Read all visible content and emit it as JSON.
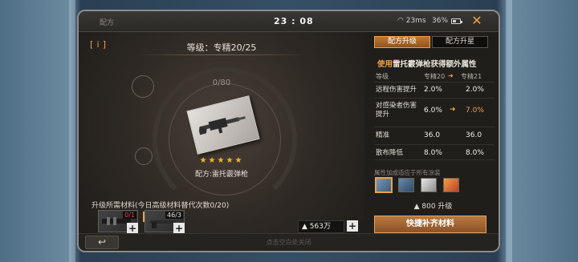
{
  "statusbar": {
    "title": "配方",
    "time": "23 : 08",
    "wifi": "23ms",
    "battery": "36%"
  },
  "left": {
    "level": "等级：专精20/25",
    "progress": "0/80",
    "stars": "★★★★★",
    "item_name": "配方:雷托霰弹枪",
    "materials_label": "升级所需材料(今日高级材料替代次数0/20)",
    "materials": [
      {
        "count": "0/1",
        "count_color": "#e04040"
      },
      {
        "count": "46/3",
        "count_color": "#f0ece4"
      }
    ],
    "currency": "563万"
  },
  "right": {
    "tabs": [
      "配方升级",
      "配方升星"
    ],
    "bonus_title_accent": "使用",
    "bonus_title_rest": "雷托霰弹枪获得额外属性",
    "header": {
      "label": "等级",
      "current": "专精20",
      "next": "专精21"
    },
    "stats": [
      {
        "name": "远程伤害提升",
        "current": "2.0%",
        "next": "2.0%",
        "up": false
      },
      {
        "name": "对感染者伤害提升",
        "current": "6.0%",
        "next": "7.0%",
        "up": true
      },
      {
        "name": "精准",
        "current": "36.0",
        "next": "36.0",
        "up": false
      },
      {
        "name": "散布降低",
        "current": "8.0%",
        "next": "8.0%",
        "up": false
      }
    ],
    "attr_label": "属性加成适应于所有涂装",
    "skins": [
      {
        "color": "#5a7896",
        "selected": true
      },
      {
        "color": "#4a6a8a",
        "selected": false
      },
      {
        "color": "#c8c8c8",
        "selected": false
      },
      {
        "color": "#d86a3a",
        "selected": false
      }
    ],
    "cost_label": "800 升级",
    "quick_button": "快捷补齐材料"
  },
  "bottom": {
    "close_hint": "点击空白处关闭"
  }
}
